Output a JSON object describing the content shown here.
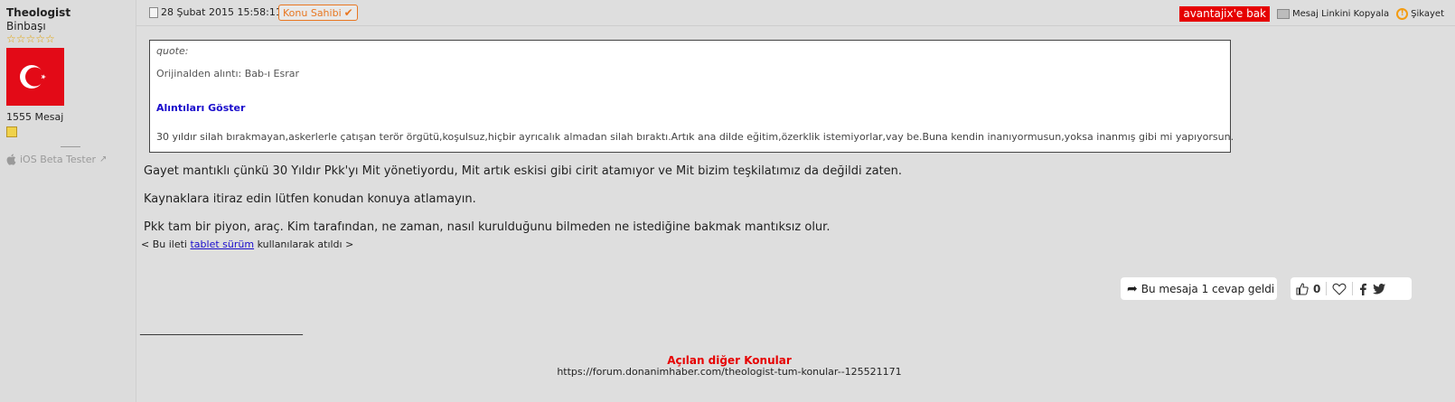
{
  "user": {
    "name": "Theologist",
    "rank": "Binbaşı",
    "stars": "☆☆☆☆☆",
    "message_count": "1555 Mesaj",
    "ios_label": "iOS Beta Tester"
  },
  "post_header": {
    "date": "28 Şubat 2015 15:58:11",
    "owner_badge": "Konu Sahibi",
    "ad_label": "avantajix'e bak",
    "copy_link": "Mesaj Linkini Kopyala",
    "report": "Şikayet"
  },
  "quote": {
    "label": "quote:",
    "original": "Orijinalden alıntı: Bab-ı Esrar",
    "show_quotes": "Alıntıları Göster",
    "text": "30 yıldır silah bırakmayan,askerlerle çatışan terör örgütü,koşulsuz,hiçbir ayrıcalık almadan silah bıraktı.Artık ana dilde eğitim,özerklik istemiyorlar,vay be.Buna kendin inanıyormusun,yoksa inanmış gibi mi yapıyorsun."
  },
  "body": {
    "p1": "Gayet mantıklı çünkü 30 Yıldır Pkk'yı Mit yönetiyordu, Mit artık eskisi gibi cirit atamıyor ve Mit bizim teşkilatımız da değildi zaten.",
    "p2": "Kaynaklara itiraz edin lütfen konudan konuya atlamayın.",
    "p3": "Pkk tam bir piyon, araç. Kim tarafından, ne zaman, nasıl kurulduğunu bilmeden ne istediğine bakmak mantıksız olur.",
    "tablet_prefix": "< Bu ileti ",
    "tablet_link": "tablet sürüm",
    "tablet_suffix": " kullanılarak atıldı >"
  },
  "actions": {
    "reply_text": "Bu mesaja 1 cevap geldi",
    "like_count": "0"
  },
  "signature": {
    "line": "______________________________",
    "other_topics": "Açılan diğer Konular",
    "url": "https://forum.donanimhaber.com/theologist-tum-konular--125521171"
  },
  "colors": {
    "accent_orange": "#e87722",
    "ad_red": "#e60000",
    "link_blue": "#1a0dcc"
  }
}
